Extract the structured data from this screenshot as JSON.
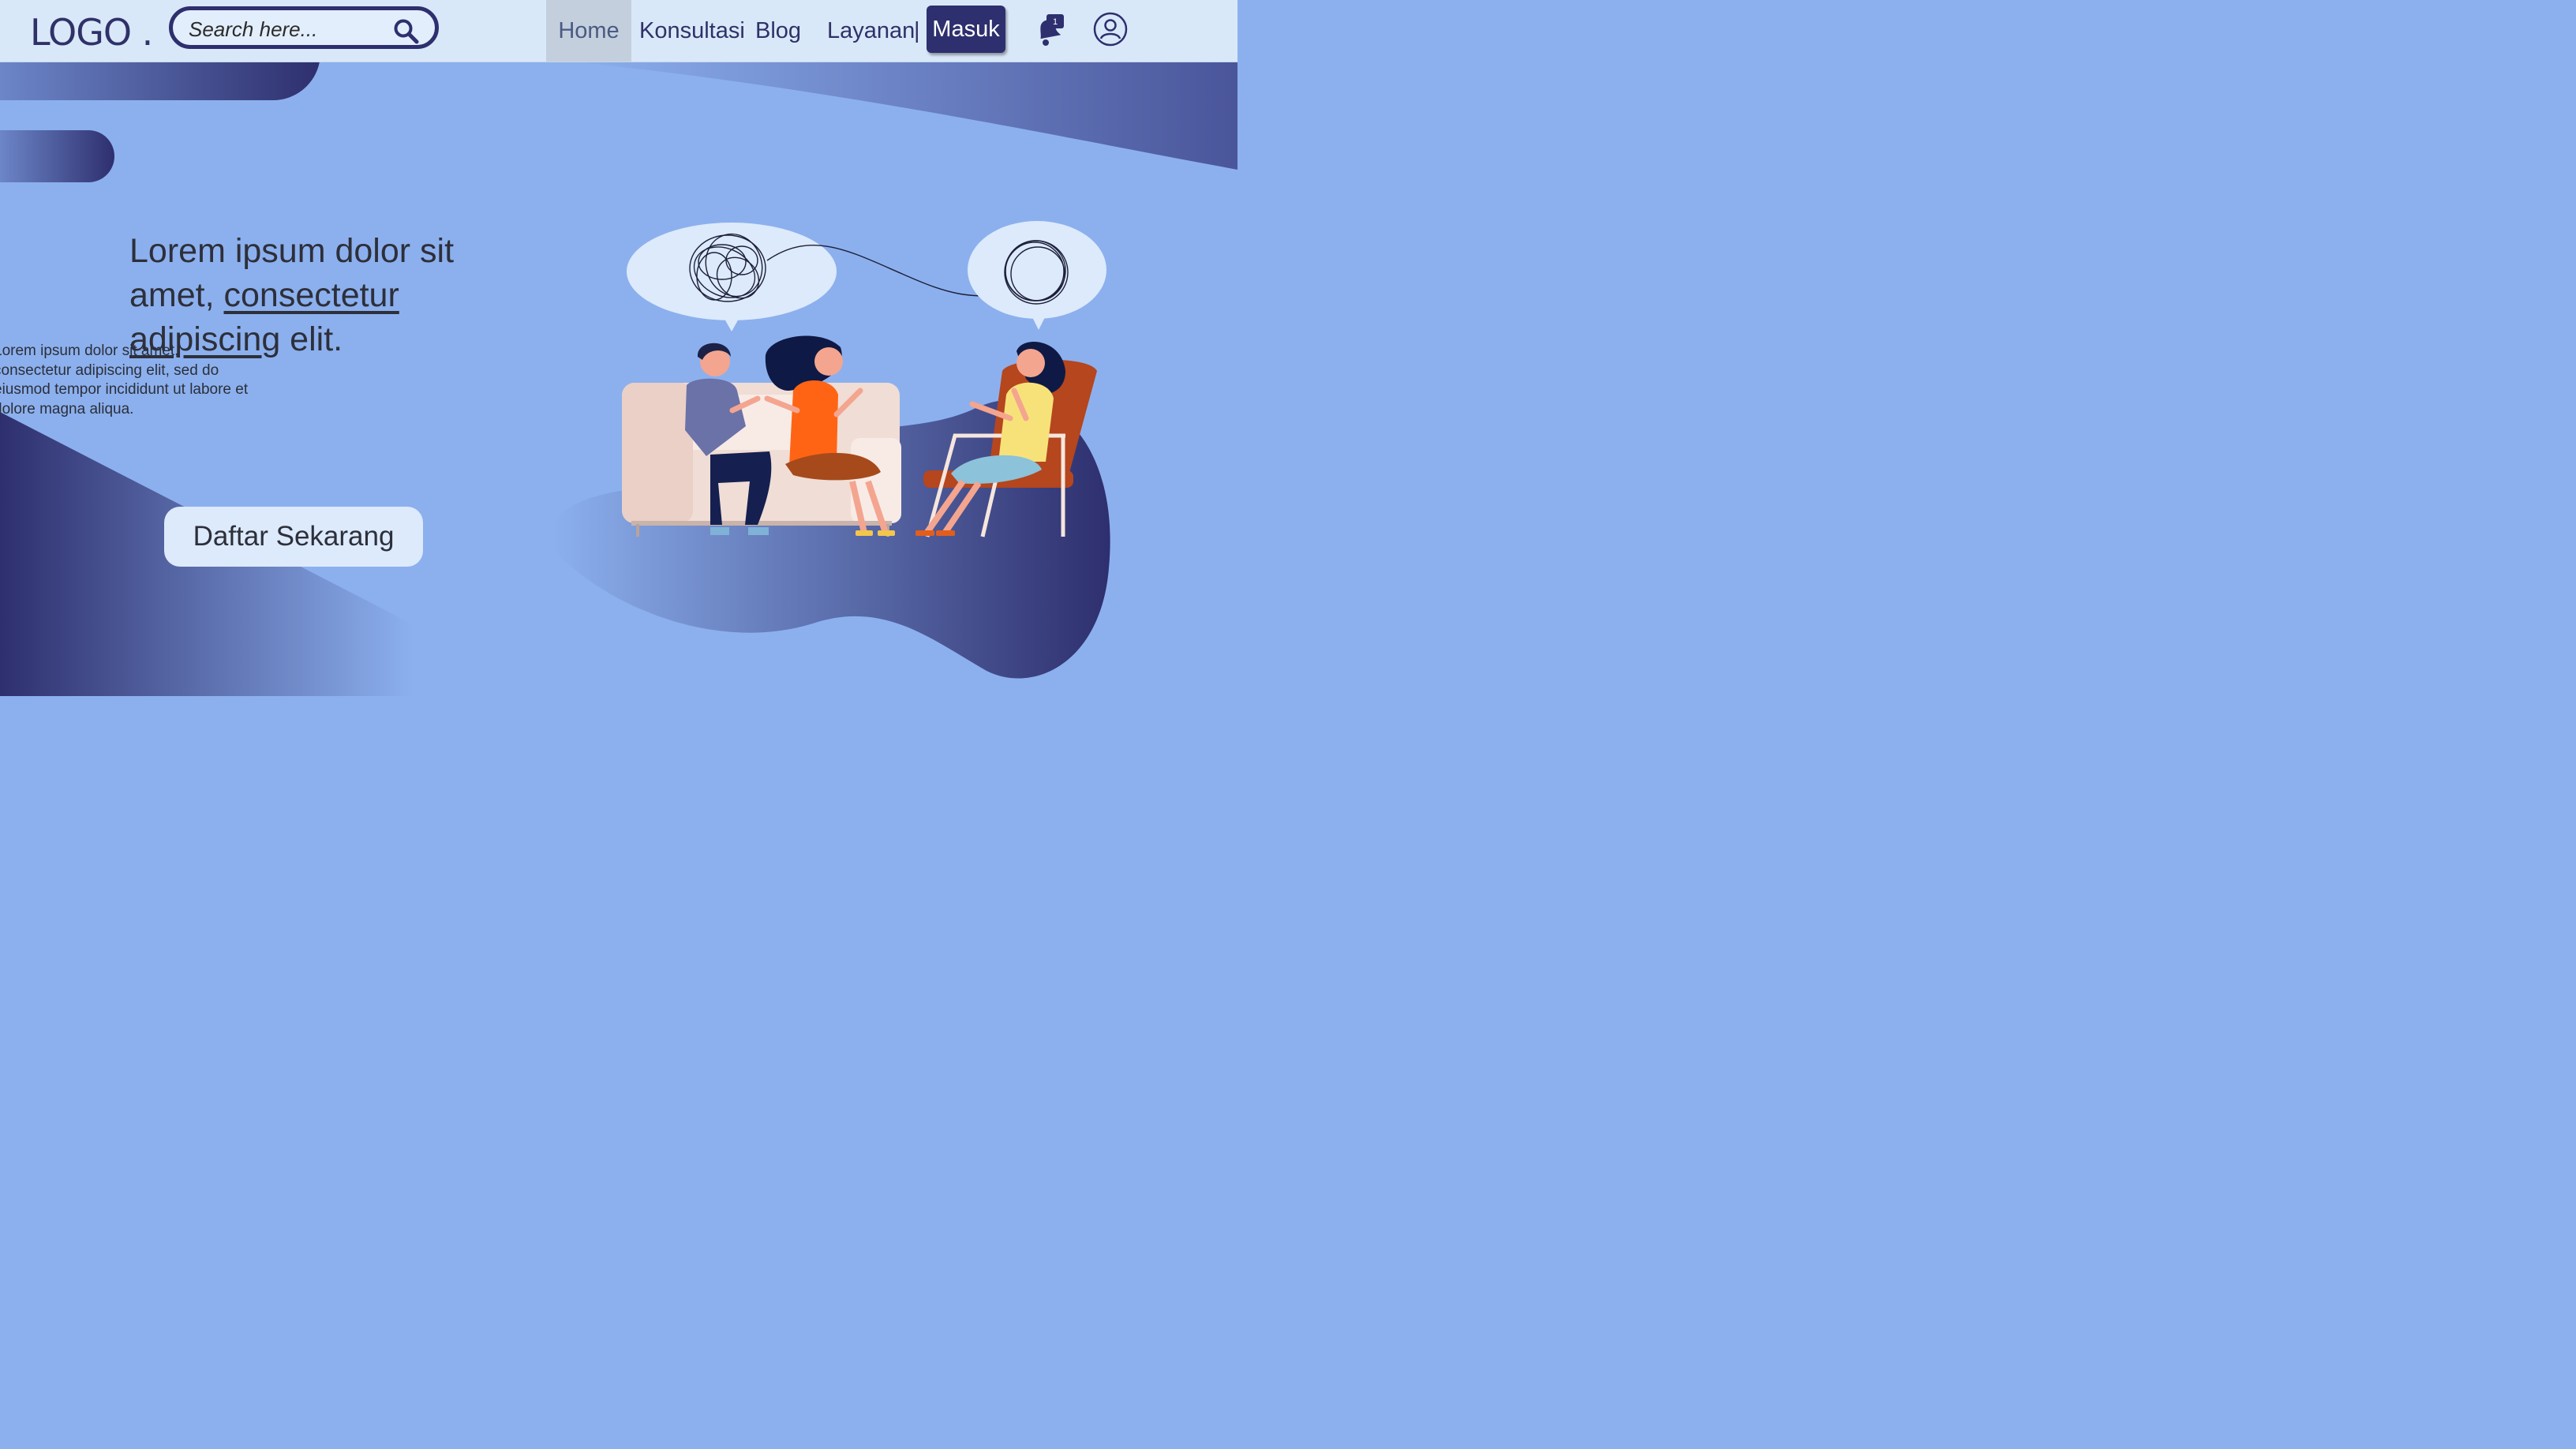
{
  "navbar": {
    "logo": "LOGO .",
    "search_placeholder": "Search here...",
    "nav_items": [
      "Home",
      "Konsultasi",
      "Blog",
      "Layanan"
    ],
    "separator": "|",
    "login_label": "Masuk",
    "notification_count": "1",
    "active_item": "Home"
  },
  "hero": {
    "headline_part1": "Lorem ipsum dolor sit amet, ",
    "headline_link": "consectetur adipiscing",
    "headline_part2": " elit.",
    "paragraph": "Lorem ipsum dolor sit amet, consectetur adipiscing elit, sed do eiusmod tempor incididunt ut labore et dolore magna aliqua.",
    "cta_label": "Daftar Sekarang"
  },
  "colors": {
    "background": "#8cb0ee",
    "navbar": "#d9e8f8",
    "brand_dark": "#2e2f6e",
    "text_dark": "#2d2f3a"
  },
  "icons": [
    "search-icon",
    "notification-bell-icon",
    "user-profile-icon"
  ]
}
